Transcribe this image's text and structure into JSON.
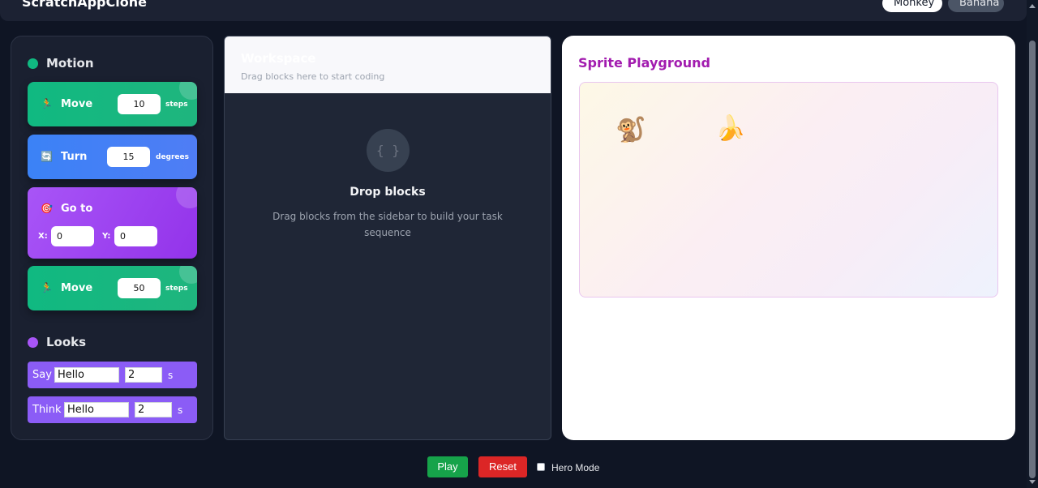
{
  "header": {
    "app_title": "ScratchAppClone",
    "sprite_tabs": [
      {
        "label": "Monkey",
        "active": true
      },
      {
        "label": "Banana",
        "active": false
      }
    ]
  },
  "sidebar": {
    "motion": {
      "title": "Motion",
      "color": "#10b981",
      "blocks": [
        {
          "icon": "🏃",
          "label": "Move",
          "value": "10",
          "unit": "steps"
        },
        {
          "icon": "🔄",
          "label": "Turn",
          "value": "15",
          "unit": "degrees"
        },
        {
          "icon": "🎯",
          "label": "Go to",
          "x_label": "X:",
          "x": "0",
          "y_label": "Y:",
          "y": "0"
        },
        {
          "icon": "🏃",
          "label": "Move",
          "value": "50",
          "unit": "steps"
        }
      ]
    },
    "looks": {
      "title": "Looks",
      "color": "#a855f7",
      "blocks": [
        {
          "label": "Say",
          "text": "Hello",
          "seconds": "2",
          "unit": "s"
        },
        {
          "label": "Think",
          "text": "Hello",
          "seconds": "2",
          "unit": "s"
        }
      ]
    }
  },
  "workspace": {
    "title": "Workspace",
    "subtitle": "Drag blocks here to start coding",
    "empty_icon": "{ }",
    "drop_title": "Drop blocks",
    "drop_description": "Drag blocks from the sidebar to build your task sequence"
  },
  "playground": {
    "title": "Sprite Playground",
    "sprites": [
      {
        "name": "monkey",
        "glyph": "🐒"
      },
      {
        "name": "banana",
        "glyph": "🍌"
      }
    ]
  },
  "controls": {
    "play_label": "Play",
    "reset_label": "Reset",
    "hero_mode_label": "Hero Mode",
    "hero_mode_checked": false
  }
}
